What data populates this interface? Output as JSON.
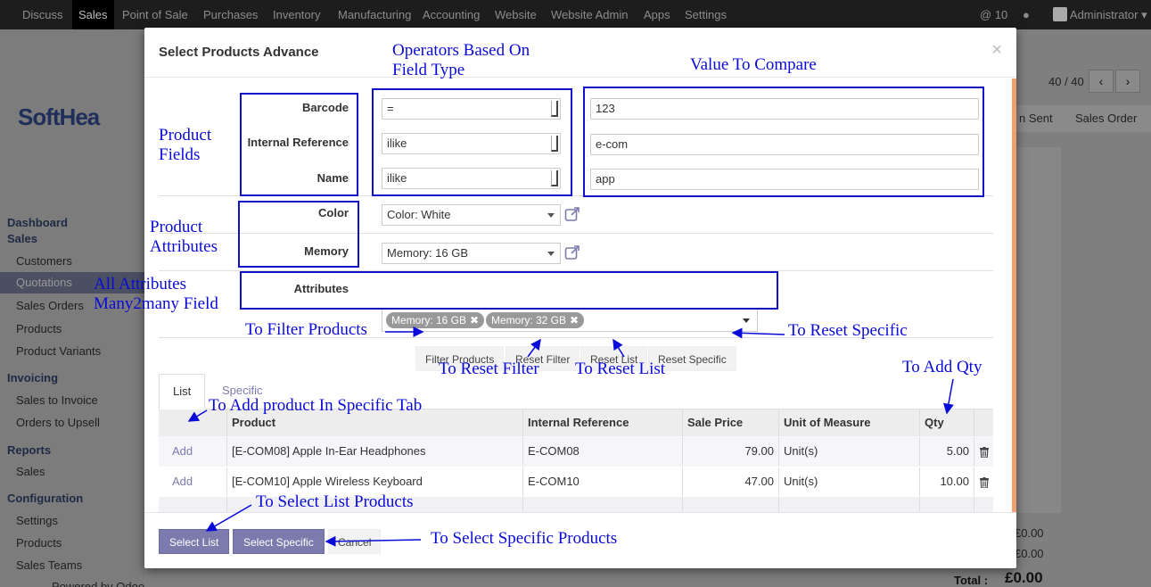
{
  "topnav": {
    "items": [
      "Discuss",
      "Sales",
      "Point of Sale",
      "Purchases",
      "Inventory",
      "Manufacturing",
      "Accounting",
      "Website",
      "Website Admin",
      "Apps",
      "Settings"
    ],
    "active_index": 1,
    "notifications_count": "10",
    "user": "Administrator"
  },
  "background": {
    "logo": "SoftHea",
    "sidebar": {
      "dashboard": "Dashboard",
      "sales_head": "Sales",
      "customers": "Customers",
      "quotations": "Quotations",
      "sales_orders": "Sales Orders",
      "products": "Products",
      "product_variants": "Product Variants",
      "invoicing": "Invoicing",
      "sales_to_invoice": "Sales to Invoice",
      "orders_to_upsell": "Orders to Upsell",
      "reports": "Reports",
      "reports_sales": "Sales",
      "configuration": "Configuration",
      "settings": "Settings",
      "config_products": "Products",
      "sales_teams": "Sales Teams",
      "powered_by": "Powered by Odoo"
    },
    "pager": "40 / 40",
    "stage_sent": "n Sent",
    "stage_order": "Sales Order",
    "amount1": "£0.00",
    "amount2": "£0.00",
    "total_label": "Total :",
    "total_value": "£0.00"
  },
  "modal": {
    "title": "Select Products Advance",
    "close": "×",
    "fields": [
      {
        "label": "Barcode",
        "operator": "=",
        "value": "123"
      },
      {
        "label": "Internal Reference",
        "operator": "ilike",
        "value": "e-com"
      },
      {
        "label": "Name",
        "operator": "ilike",
        "value": "app"
      }
    ],
    "attributes": [
      {
        "label": "Color",
        "value": "Color: White"
      },
      {
        "label": "Memory",
        "value": "Memory: 16 GB"
      }
    ],
    "many2many": {
      "label": "Attributes",
      "tags": [
        "Memory: 16 GB",
        "Memory: 32 GB"
      ]
    },
    "buttons": {
      "filter": "Filter Products",
      "reset_filter": "Reset Filter",
      "reset_list": "Reset List",
      "reset_specific": "Reset Specific"
    },
    "tabs": [
      "List",
      "Specific"
    ],
    "grid": {
      "columns": [
        "Product",
        "Internal Reference",
        "Sale Price",
        "Unit of Measure",
        "Qty"
      ],
      "add_label": "Add",
      "rows": [
        {
          "product": "[E-COM08] Apple In-Ear Headphones",
          "ref": "E-COM08",
          "price": "79.00",
          "uom": "Unit(s)",
          "qty": "5.00"
        },
        {
          "product": "[E-COM10] Apple Wireless Keyboard",
          "ref": "E-COM10",
          "price": "47.00",
          "uom": "Unit(s)",
          "qty": "10.00"
        }
      ]
    },
    "footer": {
      "select_list": "Select List",
      "select_specific": "Select Specific",
      "cancel": "Cancel"
    }
  },
  "annotations": {
    "operators": [
      "Operators Based On",
      "Field Type"
    ],
    "value_compare": "Value To Compare",
    "product_fields": [
      "Product",
      "Fields"
    ],
    "product_attributes": [
      "Product",
      "Attributes"
    ],
    "all_attributes": [
      "All Attributes",
      "Many2many Field"
    ],
    "to_filter": "To Filter Products",
    "to_reset_specific": "To Reset Specific",
    "to_reset_filter": "To Reset Filter",
    "to_reset_list": "To Reset List",
    "to_add_qty": "To Add Qty",
    "to_add_product": "To Add product In Specific Tab",
    "to_select_list": "To Select List Products",
    "to_select_specific": "To Select Specific Products"
  },
  "colors": {
    "accent": "#7c7bad",
    "annotation": "#0a0ad8",
    "scroll_thumb": "#f0a070"
  }
}
